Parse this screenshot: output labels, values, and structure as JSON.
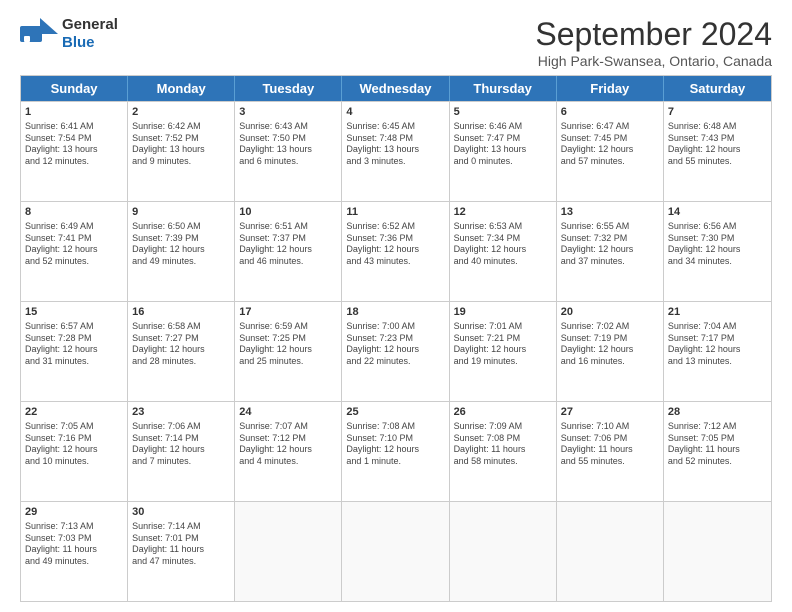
{
  "header": {
    "logo_general": "General",
    "logo_blue": "Blue",
    "month_title": "September 2024",
    "subtitle": "High Park-Swansea, Ontario, Canada"
  },
  "calendar": {
    "days_of_week": [
      "Sunday",
      "Monday",
      "Tuesday",
      "Wednesday",
      "Thursday",
      "Friday",
      "Saturday"
    ],
    "weeks": [
      [
        {
          "day": "",
          "empty": true
        },
        {
          "day": "",
          "empty": true
        },
        {
          "day": "",
          "empty": true
        },
        {
          "day": "",
          "empty": true
        },
        {
          "day": "",
          "empty": true
        },
        {
          "day": "",
          "empty": true
        },
        {
          "day": "",
          "empty": true
        }
      ],
      [
        {
          "day": "1",
          "info": "Sunrise: 6:41 AM\nSunset: 7:54 PM\nDaylight: 13 hours\nand 12 minutes."
        },
        {
          "day": "2",
          "info": "Sunrise: 6:42 AM\nSunset: 7:52 PM\nDaylight: 13 hours\nand 9 minutes."
        },
        {
          "day": "3",
          "info": "Sunrise: 6:43 AM\nSunset: 7:50 PM\nDaylight: 13 hours\nand 6 minutes."
        },
        {
          "day": "4",
          "info": "Sunrise: 6:45 AM\nSunset: 7:48 PM\nDaylight: 13 hours\nand 3 minutes."
        },
        {
          "day": "5",
          "info": "Sunrise: 6:46 AM\nSunset: 7:47 PM\nDaylight: 13 hours\nand 0 minutes."
        },
        {
          "day": "6",
          "info": "Sunrise: 6:47 AM\nSunset: 7:45 PM\nDaylight: 12 hours\nand 57 minutes."
        },
        {
          "day": "7",
          "info": "Sunrise: 6:48 AM\nSunset: 7:43 PM\nDaylight: 12 hours\nand 55 minutes."
        }
      ],
      [
        {
          "day": "8",
          "info": "Sunrise: 6:49 AM\nSunset: 7:41 PM\nDaylight: 12 hours\nand 52 minutes."
        },
        {
          "day": "9",
          "info": "Sunrise: 6:50 AM\nSunset: 7:39 PM\nDaylight: 12 hours\nand 49 minutes."
        },
        {
          "day": "10",
          "info": "Sunrise: 6:51 AM\nSunset: 7:37 PM\nDaylight: 12 hours\nand 46 minutes."
        },
        {
          "day": "11",
          "info": "Sunrise: 6:52 AM\nSunset: 7:36 PM\nDaylight: 12 hours\nand 43 minutes."
        },
        {
          "day": "12",
          "info": "Sunrise: 6:53 AM\nSunset: 7:34 PM\nDaylight: 12 hours\nand 40 minutes."
        },
        {
          "day": "13",
          "info": "Sunrise: 6:55 AM\nSunset: 7:32 PM\nDaylight: 12 hours\nand 37 minutes."
        },
        {
          "day": "14",
          "info": "Sunrise: 6:56 AM\nSunset: 7:30 PM\nDaylight: 12 hours\nand 34 minutes."
        }
      ],
      [
        {
          "day": "15",
          "info": "Sunrise: 6:57 AM\nSunset: 7:28 PM\nDaylight: 12 hours\nand 31 minutes."
        },
        {
          "day": "16",
          "info": "Sunrise: 6:58 AM\nSunset: 7:27 PM\nDaylight: 12 hours\nand 28 minutes."
        },
        {
          "day": "17",
          "info": "Sunrise: 6:59 AM\nSunset: 7:25 PM\nDaylight: 12 hours\nand 25 minutes."
        },
        {
          "day": "18",
          "info": "Sunrise: 7:00 AM\nSunset: 7:23 PM\nDaylight: 12 hours\nand 22 minutes."
        },
        {
          "day": "19",
          "info": "Sunrise: 7:01 AM\nSunset: 7:21 PM\nDaylight: 12 hours\nand 19 minutes."
        },
        {
          "day": "20",
          "info": "Sunrise: 7:02 AM\nSunset: 7:19 PM\nDaylight: 12 hours\nand 16 minutes."
        },
        {
          "day": "21",
          "info": "Sunrise: 7:04 AM\nSunset: 7:17 PM\nDaylight: 12 hours\nand 13 minutes."
        }
      ],
      [
        {
          "day": "22",
          "info": "Sunrise: 7:05 AM\nSunset: 7:16 PM\nDaylight: 12 hours\nand 10 minutes."
        },
        {
          "day": "23",
          "info": "Sunrise: 7:06 AM\nSunset: 7:14 PM\nDaylight: 12 hours\nand 7 minutes."
        },
        {
          "day": "24",
          "info": "Sunrise: 7:07 AM\nSunset: 7:12 PM\nDaylight: 12 hours\nand 4 minutes."
        },
        {
          "day": "25",
          "info": "Sunrise: 7:08 AM\nSunset: 7:10 PM\nDaylight: 12 hours\nand 1 minute."
        },
        {
          "day": "26",
          "info": "Sunrise: 7:09 AM\nSunset: 7:08 PM\nDaylight: 11 hours\nand 58 minutes."
        },
        {
          "day": "27",
          "info": "Sunrise: 7:10 AM\nSunset: 7:06 PM\nDaylight: 11 hours\nand 55 minutes."
        },
        {
          "day": "28",
          "info": "Sunrise: 7:12 AM\nSunset: 7:05 PM\nDaylight: 11 hours\nand 52 minutes."
        }
      ],
      [
        {
          "day": "29",
          "info": "Sunrise: 7:13 AM\nSunset: 7:03 PM\nDaylight: 11 hours\nand 49 minutes."
        },
        {
          "day": "30",
          "info": "Sunrise: 7:14 AM\nSunset: 7:01 PM\nDaylight: 11 hours\nand 47 minutes."
        },
        {
          "day": "",
          "empty": true
        },
        {
          "day": "",
          "empty": true
        },
        {
          "day": "",
          "empty": true
        },
        {
          "day": "",
          "empty": true
        },
        {
          "day": "",
          "empty": true
        }
      ]
    ]
  }
}
